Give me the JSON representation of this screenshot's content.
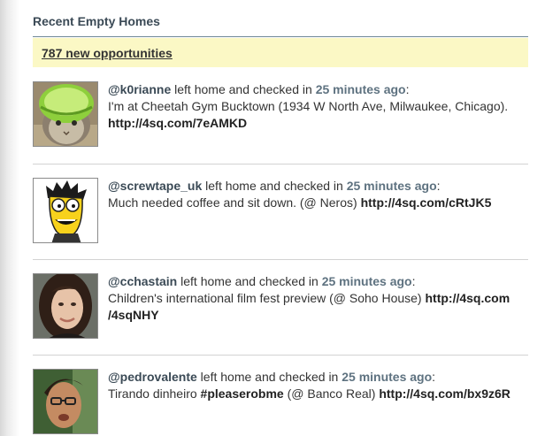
{
  "section": {
    "title": "Recent Empty Homes",
    "new_opportunities": "787 new opportunities"
  },
  "items": [
    {
      "user": "@k0rianne",
      "action": " left home and checked in ",
      "time": "25 minutes ago",
      "colon": ":",
      "line1": "I'm at Cheetah Gym Bucktown (1934 W North Ave, Milwaukee, Chicago).",
      "link": "http://4sq.com/7eAMKD"
    },
    {
      "user": "@screwtape_uk",
      "action": " left home and checked in ",
      "time": "25 minutes ago",
      "colon": ":",
      "line1": "Much needed coffee and sit down. (@ Neros) ",
      "link": "http://4sq.com/cRtJK5"
    },
    {
      "user": "@cchastain",
      "action": " left home and checked in ",
      "time": "25 minutes ago",
      "colon": ":",
      "line1": "Children's international film fest preview (@ Soho House) ",
      "link1": "http://4sq.com",
      "link2": "/4sqNHY"
    },
    {
      "user": "@pedrovalente",
      "action": " left home and checked in ",
      "time": "25 minutes ago",
      "colon": ":",
      "line_pre": "Tirando dinheiro ",
      "hashtag": "#pleaserobme",
      "line_post": " (@ Banco Real) ",
      "link": "http://4sq.com/bx9z6R"
    }
  ],
  "colors": {
    "banner_bg": "#fbf8c5",
    "username": "#3b4a56",
    "timestamp": "#5e7280",
    "rule": "#6f8796"
  }
}
